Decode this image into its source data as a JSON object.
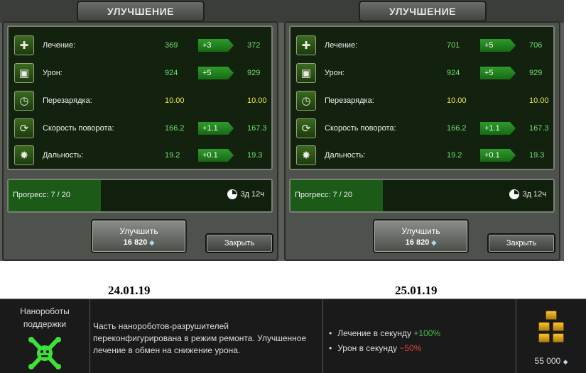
{
  "panels": [
    {
      "title": "УЛУЧШЕНИЕ",
      "stats": [
        {
          "icon": "heal-icon",
          "glyph": "✚",
          "label": "Лечение:",
          "before": "369",
          "delta": "+3",
          "after": "372"
        },
        {
          "icon": "damage-icon",
          "glyph": "▣",
          "label": "Урон:",
          "before": "924",
          "delta": "+5",
          "after": "929"
        },
        {
          "icon": "reload-icon",
          "glyph": "◷",
          "label": "Перезарядка:",
          "before": "10.00",
          "delta": "",
          "after": "10.00"
        },
        {
          "icon": "rotation-speed-icon",
          "glyph": "⟳",
          "label": "Скорость поворота:",
          "before": "166.2",
          "delta": "+1.1",
          "after": "167.3"
        },
        {
          "icon": "range-icon",
          "glyph": "✸",
          "label": "Дальность:",
          "before": "19.2",
          "delta": "+0.1",
          "after": "19.3"
        }
      ],
      "progress_label": "Прогресс: 7 / 20",
      "progress_fraction": 0.35,
      "timer": "3д 12ч",
      "upgrade_label": "Улучшить",
      "upgrade_price": "16 820",
      "close_label": "Закрыть"
    },
    {
      "title": "УЛУЧШЕНИЕ",
      "stats": [
        {
          "icon": "heal-icon",
          "glyph": "✚",
          "label": "Лечение:",
          "before": "701",
          "delta": "+5",
          "after": "706"
        },
        {
          "icon": "damage-icon",
          "glyph": "▣",
          "label": "Урон:",
          "before": "924",
          "delta": "+5",
          "after": "929"
        },
        {
          "icon": "reload-icon",
          "glyph": "◷",
          "label": "Перезарядка:",
          "before": "10.00",
          "delta": "",
          "after": "10.00"
        },
        {
          "icon": "rotation-speed-icon",
          "glyph": "⟳",
          "label": "Скорость поворота:",
          "before": "166.2",
          "delta": "+1.1",
          "after": "167.3"
        },
        {
          "icon": "range-icon",
          "glyph": "✸",
          "label": "Дальность:",
          "before": "19.2",
          "delta": "+0.1",
          "after": "19.3"
        }
      ],
      "progress_label": "Прогресс: 7 / 20",
      "progress_fraction": 0.35,
      "timer": "3д 12ч",
      "upgrade_label": "Улучшить",
      "upgrade_price": "16 820",
      "close_label": "Закрыть"
    }
  ],
  "dates": {
    "left": "24.01.19",
    "right": "25.01.19"
  },
  "module": {
    "name": "Нанороботы поддержки",
    "description": "Часть нанороботов-разрушителей переконфигурирована в режим ремонта. Улучшенное лечение в обмен на снижение урона.",
    "effects": [
      {
        "label": "Лечение в секунду",
        "value": "+100%",
        "sign": "pos"
      },
      {
        "label": "Урон в секунду",
        "value": "−50%",
        "sign": "neg"
      }
    ],
    "price": "55 000",
    "icon": "nanobot-icon",
    "currency_icon": "gold-bars-icon"
  },
  "colors": {
    "stat_green": "#6ee06a",
    "stat_yellow": "#f5e84a",
    "badge_green": "#2e9a2a",
    "panel_bg": "#13220f",
    "positive": "#4ec04e",
    "negative": "#e0443a"
  }
}
